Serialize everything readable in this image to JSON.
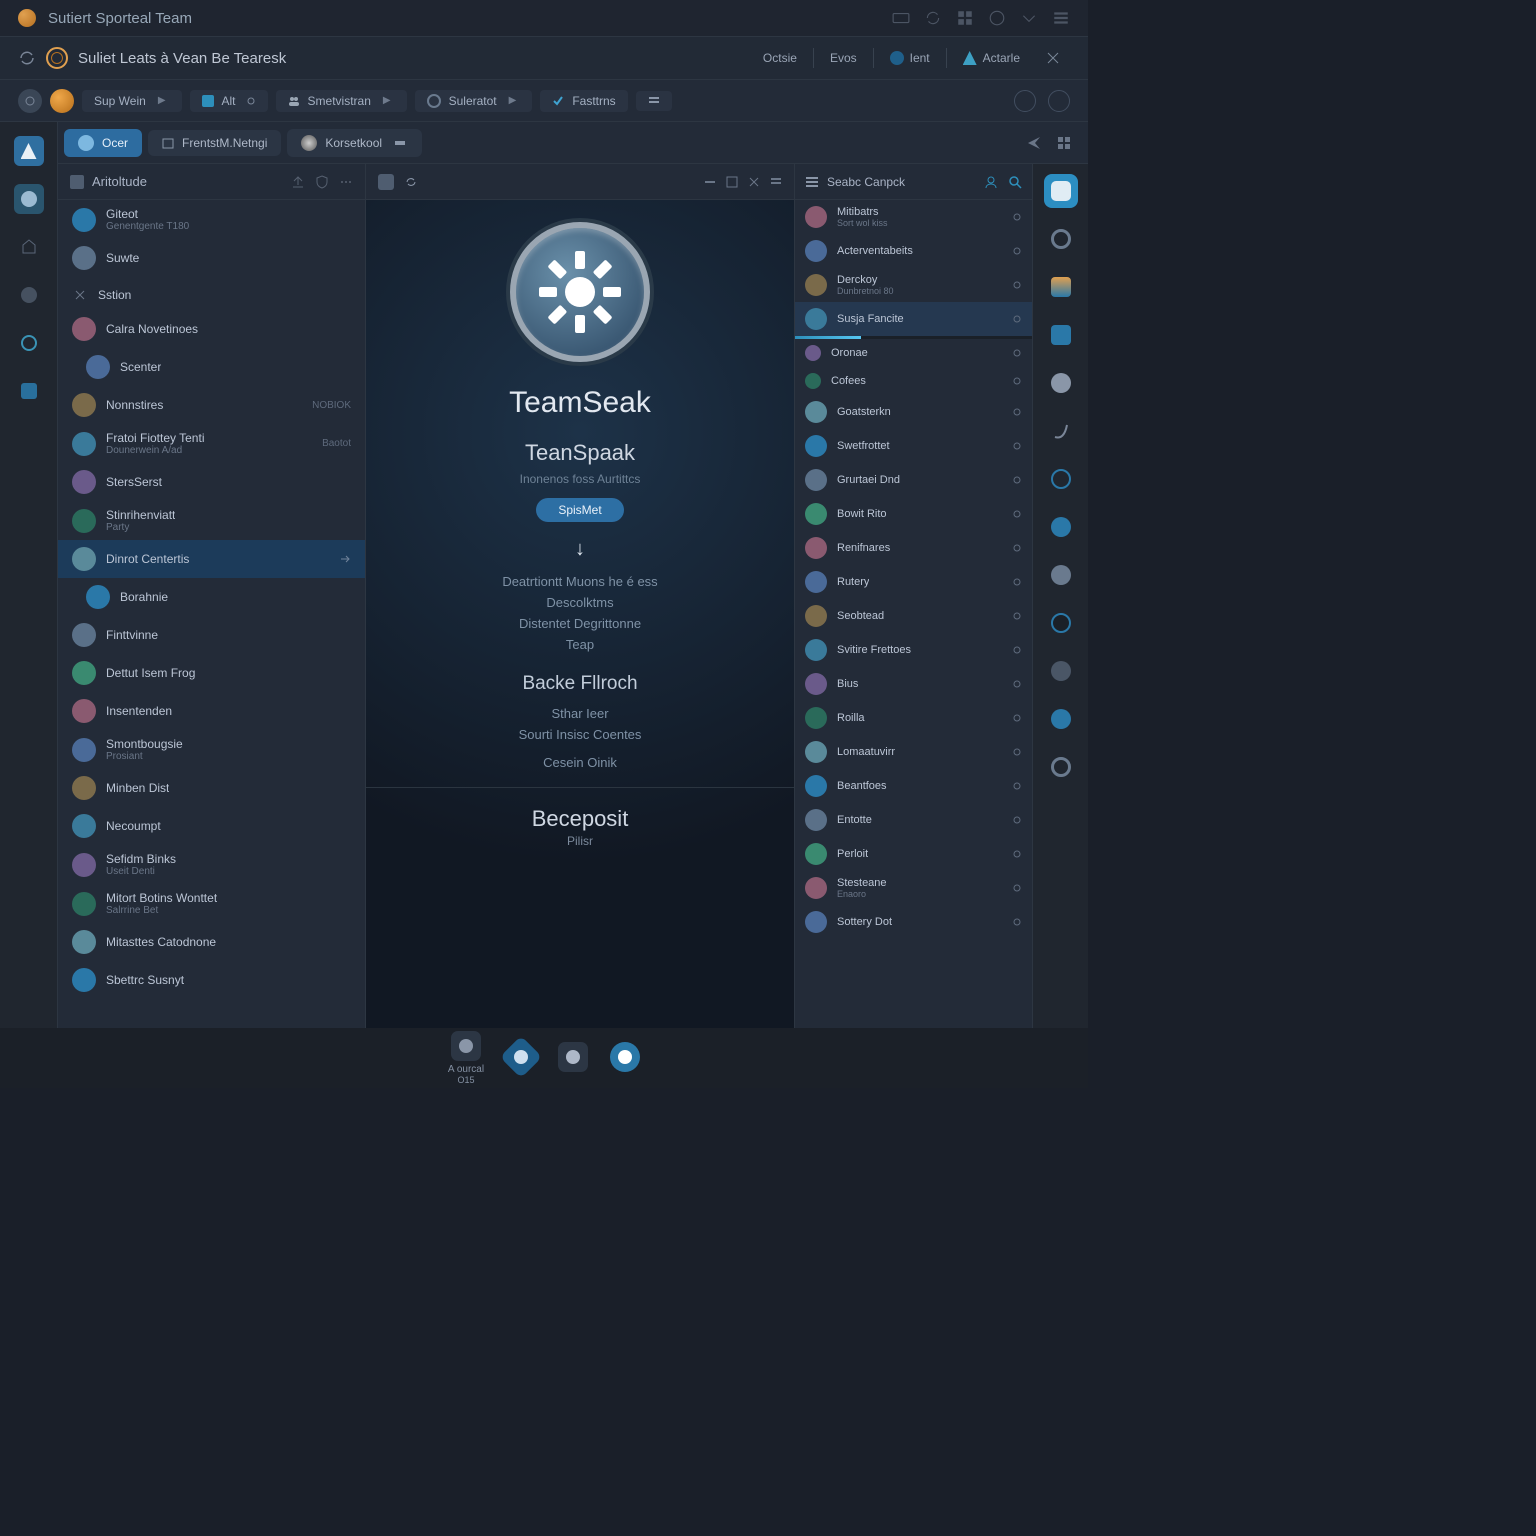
{
  "titlebar": {
    "text": "Sutiert Sporteal Team"
  },
  "header": {
    "title": "Suliet Leats à Vean Be Tearesk",
    "buttons": [
      "Octsie",
      "Evos",
      "Ient",
      "Actarle"
    ]
  },
  "nav": {
    "items": [
      "Sup Wein",
      "Alt",
      "Smetvistran",
      "Suleratot",
      "Fasttrns"
    ]
  },
  "tabs": {
    "items": [
      {
        "label": "Ocer",
        "active": true
      },
      {
        "label": "FrentstM.Netngi",
        "active": false
      },
      {
        "label": "Korsetkool",
        "active": false
      }
    ]
  },
  "left_panel": {
    "header": "Aritoltude",
    "items": [
      {
        "t1": "Giteot",
        "t2": "Genentgente T180"
      },
      {
        "t1": "Suwte"
      },
      {
        "section": "Sstion"
      },
      {
        "t1": "Calra Novetinoes"
      },
      {
        "t1": "Scenter",
        "sub": true
      },
      {
        "t1": "Nonnstires",
        "meta": "NOBIOK"
      },
      {
        "t1": "Fratoi Fiottey Tenti",
        "t2": "Dounerwein A/ad",
        "meta": "Baotot"
      },
      {
        "t1": "StersSerst"
      },
      {
        "t1": "Stinrihenviatt",
        "t2": "Party"
      },
      {
        "t1": "Dinrot Centertis",
        "selected": true
      },
      {
        "t1": "Borahnie",
        "sub": true
      },
      {
        "t1": "Finttvinne"
      },
      {
        "t1": "Dettut Isem Frog"
      },
      {
        "t1": "Insentenden"
      },
      {
        "t1": "Smontbougsie",
        "t2": "Prosiant"
      },
      {
        "t1": "Minben Dist"
      },
      {
        "t1": "Necoumpt"
      },
      {
        "t1": "Sefidm Binks",
        "t2": "Useit Denti"
      },
      {
        "t1": "Mitort Botins Wonttet",
        "t2": "Salrrine Bet"
      },
      {
        "t1": "Mitasttes Catodnone"
      },
      {
        "t1": "Sbettrc Susnyt"
      }
    ]
  },
  "splash": {
    "h1": "TeamSeak",
    "h2": "TeanSpaak",
    "sub": "Inonenos foss Aurtittcs",
    "btn": "SpisMet",
    "lines": [
      "Deatrtiontt Muons he é ess",
      "Descolktms",
      "Distentet Degrittonne",
      "Teap"
    ],
    "section": "Backe Fllroch",
    "lines2": [
      "Sthar Ieer",
      "Sourti Insisc Coentes",
      "Cesein Oinik"
    ],
    "big": "Beceposit",
    "small": "Pilisr"
  },
  "right_panel": {
    "header": "Seabc Canpck",
    "items": [
      {
        "ta": "Mitibatrs",
        "tb": "Sort wol kiss"
      },
      {
        "ta": "Acterventabeits"
      },
      {
        "ta": "Derckoy",
        "tb": "Dunbretnoi 80"
      },
      {
        "ta": "Susja Fancite",
        "sel": true
      },
      {
        "ta": "Oronae",
        "tiny": true
      },
      {
        "ta": "Cofees",
        "tiny": true
      },
      {
        "ta": "Goatsterkn"
      },
      {
        "ta": "Swetfrottet"
      },
      {
        "ta": "Grurtaei Dnd"
      },
      {
        "ta": "Bowit Rito"
      },
      {
        "ta": "Renifnares"
      },
      {
        "ta": "Rutery"
      },
      {
        "ta": "Seobtead"
      },
      {
        "ta": "Svitire Frettoes"
      },
      {
        "ta": "Bius"
      },
      {
        "ta": "Roilla"
      },
      {
        "ta": "Lomaatuvirr"
      },
      {
        "ta": "Beantfoes"
      },
      {
        "ta": "Entotte"
      },
      {
        "ta": "Perloit"
      },
      {
        "ta": "Stesteane",
        "tb": "Enaoro"
      },
      {
        "ta": "Sottery Dot"
      }
    ]
  },
  "bottom": {
    "label1": "A ourcal",
    "label1b": "O15"
  },
  "colors": {
    "accent": "#2d8fbb",
    "bg": "#232b38"
  }
}
